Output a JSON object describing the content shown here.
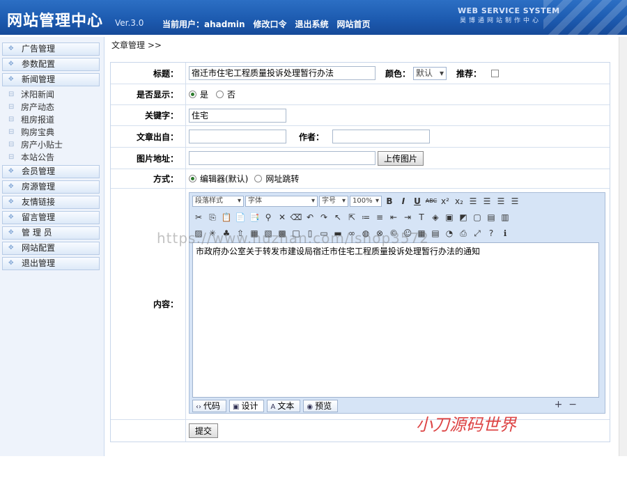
{
  "header": {
    "title": "网站管理中心",
    "version": "Ver.3.0",
    "current_user_label": "当前用户：",
    "current_user": "ahadmin",
    "nav": [
      "修改口令",
      "退出系统",
      "网站首页"
    ],
    "brand_en": "WEB SERVICE SYSTEM",
    "brand_cn": "昊博通网站制作中心"
  },
  "sidebar": {
    "items_top": [
      "广告管理",
      "参数配置",
      "新闻管理"
    ],
    "sub_items": [
      "沭阳新闻",
      "房产动态",
      "租房报道",
      "购房宝典",
      "房产小贴士",
      "本站公告"
    ],
    "items_bottom": [
      "会员管理",
      "房源管理",
      "友情链接",
      "留言管理",
      "管 理 员",
      "网站配置",
      "退出管理"
    ]
  },
  "breadcrumb": "文章管理 >>",
  "form": {
    "title_label": "标题：",
    "title_value": "宿迁市住宅工程质量投诉处理暂行办法",
    "color_label": "颜色：",
    "color_value": "默认",
    "recommend_label": "推荐：",
    "display_label": "是否显示：",
    "display_yes": "是",
    "display_no": "否",
    "keyword_label": "关键字：",
    "keyword_value": "住宅",
    "source_label": "文章出自：",
    "author_label": "作者：",
    "image_label": "图片地址：",
    "upload_button": "上传图片",
    "mode_label": "方式：",
    "mode_editor": "编辑器(默认)",
    "mode_redirect": "网址跳转",
    "content_label": "内容：",
    "submit_button": "提交"
  },
  "editor": {
    "paragraph_style": "段落样式",
    "font": "字体",
    "font_size": "字号",
    "zoom": "100%",
    "content": "市政府办公室关于转发市建设局宿迁市住宅工程质量投诉处理暂行办法的通知",
    "tabs": [
      "代码",
      "设计",
      "文本",
      "预览"
    ]
  },
  "watermark": "https://www.huzhan.com/ishop3572",
  "signature": "小刀源码世界"
}
